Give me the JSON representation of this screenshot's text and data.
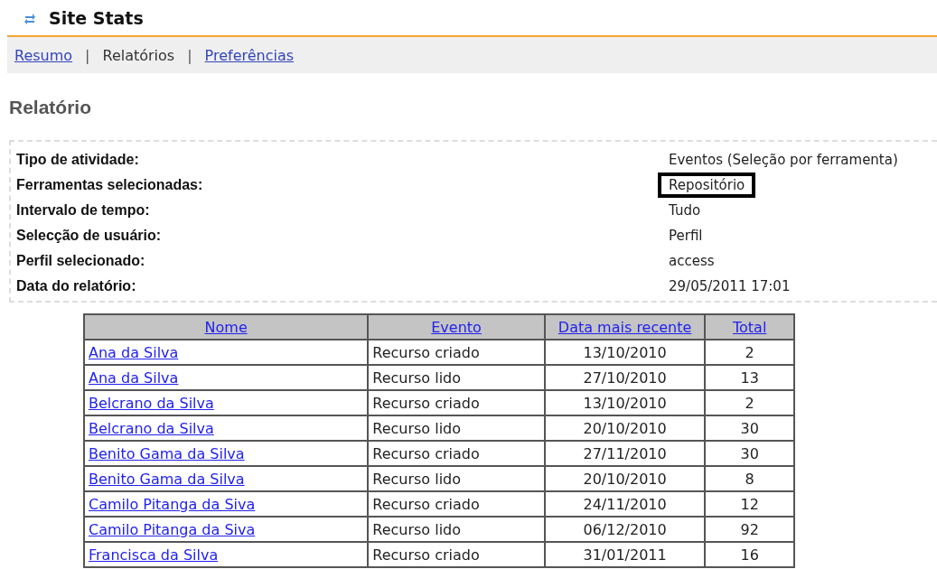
{
  "app": {
    "title": "Site Stats"
  },
  "nav": [
    {
      "label": "Resumo",
      "selected": false
    },
    {
      "label": "Relatórios",
      "selected": true
    },
    {
      "label": "Preferências",
      "selected": false
    }
  ],
  "nav_separators": [
    "|",
    "|"
  ],
  "heading": "Relatório",
  "details": [
    {
      "label": "Tipo de atividade:",
      "value": "Eventos (Seleção por ferramenta)",
      "highlighted": false
    },
    {
      "label": "Ferramentas selecionadas:",
      "value": "Repositório",
      "highlighted": true
    },
    {
      "label": "Intervalo de tempo:",
      "value": "Tudo",
      "highlighted": false
    },
    {
      "label": "Selecção de usuário:",
      "value": "Perfil",
      "highlighted": false
    },
    {
      "label": "Perfil selecionado:",
      "value": "access",
      "highlighted": false
    },
    {
      "label": "Data do relatório:",
      "value": "29/05/2011 17:01",
      "highlighted": false
    }
  ],
  "table": {
    "columns": [
      "Nome",
      "Evento",
      "Data mais recente",
      "Total"
    ],
    "rows": [
      [
        "Ana da Silva",
        "Recurso criado",
        "13/10/2010",
        "2"
      ],
      [
        "Ana da Silva",
        "Recurso lido",
        "27/10/2010",
        "13"
      ],
      [
        "Belcrano da Silva",
        "Recurso criado",
        "13/10/2010",
        "2"
      ],
      [
        "Belcrano da Silva",
        "Recurso lido",
        "20/10/2010",
        "30"
      ],
      [
        "Benito Gama da Silva",
        "Recurso criado",
        "27/11/2010",
        "30"
      ],
      [
        "Benito Gama da Silva",
        "Recurso lido",
        "20/10/2010",
        "8"
      ],
      [
        "Camilo Pitanga da Siva",
        "Recurso criado",
        "24/11/2010",
        "12"
      ],
      [
        "Camilo Pitanga da Siva",
        "Recurso lido",
        "06/12/2010",
        "92"
      ],
      [
        "Francisca da Silva",
        "Recurso criado",
        "31/01/2011",
        "16"
      ]
    ]
  }
}
